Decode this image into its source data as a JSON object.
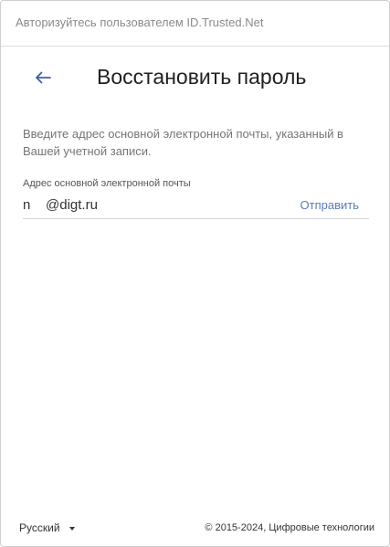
{
  "header": {
    "title": "Авторизуйтесь пользователем ID.Trusted.Net"
  },
  "page": {
    "back_icon": "arrow-left-icon",
    "title": "Восстановить пароль",
    "description": "Введите адрес основной электронной почты, указанный в Вашей учетной записи."
  },
  "form": {
    "email_label": "Адрес основной электронной почты",
    "email_value": "n    @digt.ru",
    "send_label": "Отправить"
  },
  "footer": {
    "language": "Русский",
    "language_icon": "caret-down-icon",
    "copyright": "© 2015-2024, Цифровые технологии"
  },
  "colors": {
    "accent": "#5b7bbd",
    "title": "#212121",
    "muted": "#757575"
  }
}
